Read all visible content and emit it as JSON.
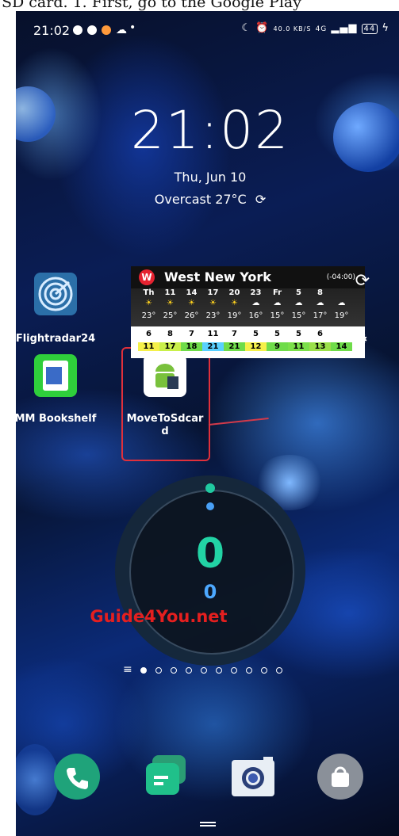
{
  "caption": "SD card. 1. First, go to the Google Play",
  "status_bar": {
    "time": "21:02",
    "network_speed": "40.0 KB/S",
    "network": "4G",
    "battery": "44",
    "colors": {
      "ind1": "#ffffff",
      "ind2": "#ffffff",
      "ind3": "#ff9a3c",
      "ind4": "#ffffff"
    }
  },
  "lockscreen": {
    "clock": "21:02",
    "date": "Thu, Jun 10",
    "weather": "Overcast 27°C"
  },
  "apps": [
    {
      "label": "Flightradar24",
      "icon": "flightradar-icon"
    },
    {
      "label": "MM Bookshelf",
      "icon": "bookshelf-icon"
    },
    {
      "label": "MoveToSdcard",
      "icon": "android-sdcard-icon"
    }
  ],
  "weather_widget": {
    "city": "West New York",
    "timezone": "(-04:00)",
    "days": [
      {
        "d": "Th",
        "n": "",
        "t": "23°"
      },
      {
        "d": "",
        "n": "11",
        "t": "25°"
      },
      {
        "d": "",
        "n": "14",
        "t": "26°"
      },
      {
        "d": "",
        "n": "17",
        "t": "23°"
      },
      {
        "d": "",
        "n": "20",
        "t": "19°"
      },
      {
        "d": "",
        "n": "23",
        "t": "16°"
      },
      {
        "d": "Fr",
        "n": "",
        "t": "15°"
      },
      {
        "d": "",
        "n": "5",
        "t": "15°"
      },
      {
        "d": "",
        "n": "8",
        "t": "17°"
      },
      {
        "d": "",
        "n": "",
        "t": "19°"
      }
    ],
    "wind_top": [
      "6",
      "8",
      "7",
      "11",
      "7",
      "5",
      "5",
      "5",
      "6",
      ""
    ],
    "wind_bottom": [
      "11",
      "17",
      "18",
      "21",
      "21",
      "12",
      "9",
      "11",
      "13",
      "14"
    ],
    "wind_colors": [
      "#f5f04a",
      "#c9f04a",
      "#6fdc4a",
      "#59d0ff",
      "#6fdc4a",
      "#f5f04a",
      "#6fdc4a",
      "#7be04a",
      "#9be04a",
      "#6fdc4a"
    ]
  },
  "step_counter": {
    "value": "0",
    "sub": "0"
  },
  "watermark": "Guide4You.net",
  "page_indicator": {
    "count": 10,
    "active": 0
  },
  "dock": [
    "phone-icon",
    "messages-icon",
    "camera-icon",
    "store-icon"
  ]
}
